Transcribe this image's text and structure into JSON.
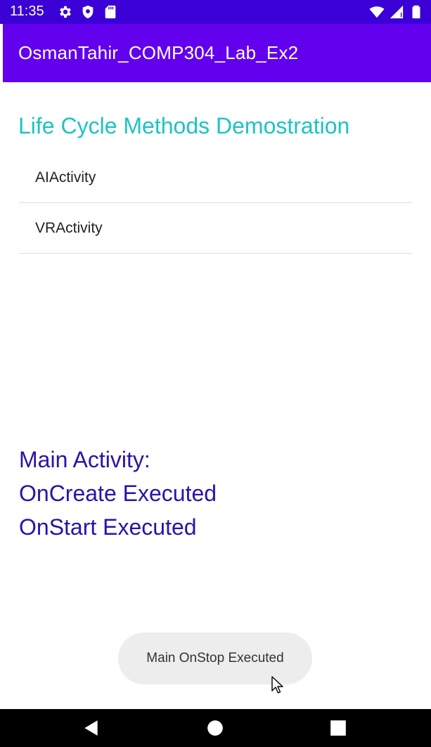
{
  "status_bar": {
    "time": "11:35",
    "left_icons": [
      "gear-icon",
      "shield-icon",
      "sd-card-icon"
    ],
    "right_icons": [
      "wifi-icon",
      "signal-icon",
      "battery-icon"
    ],
    "color": "#3a00d6"
  },
  "action_bar": {
    "title": "OsmanTahir_COMP304_Lab_Ex2",
    "color": "#6200ee"
  },
  "main": {
    "heading": "Life Cycle Methods Demostration",
    "heading_color": "#1ec3c3",
    "activities": [
      {
        "label": "AIActivity"
      },
      {
        "label": "VRActivity"
      }
    ],
    "lifecycle_lines": [
      "Main Activity:",
      "OnCreate Executed",
      "OnStart Executed"
    ],
    "lifecycle_color": "#2c12a8"
  },
  "toast": {
    "message": "Main OnStop Executed"
  },
  "nav_bar": {
    "buttons": [
      "back-icon",
      "home-icon",
      "recents-icon"
    ]
  }
}
